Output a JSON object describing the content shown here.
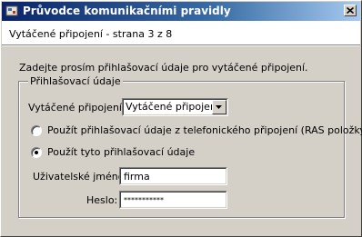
{
  "window": {
    "title": "Průvodce komunikačními pravidly",
    "subtitle": "Vytáčené připojení - strana 3 z 8"
  },
  "instruction": "Zadejte prosím přihlašovací údaje pro vytáčené připojení.",
  "group": {
    "legend": "Přihlašovací údaje",
    "dialup_label": "Vytáčené připojení:",
    "dialup_selected": "Vytáčené připojení",
    "radio_ras": "Použít přihlašovací údaje z telefonického připojení (RAS položky)",
    "radio_custom": "Použít tyto přihlašovací údaje",
    "radio_custom_selected": true,
    "username_label": "Uživatelské jméno:",
    "username_value": "firma",
    "password_label": "Heslo:",
    "password_mask": "***********"
  },
  "icons": {
    "app": "wizard-icon",
    "close": "close-icon",
    "dropdown": "chevron-down-icon"
  },
  "colors": {
    "titlebar_start": "#0a246a",
    "titlebar_end": "#a6caf0",
    "face": "#d4d0c8"
  }
}
